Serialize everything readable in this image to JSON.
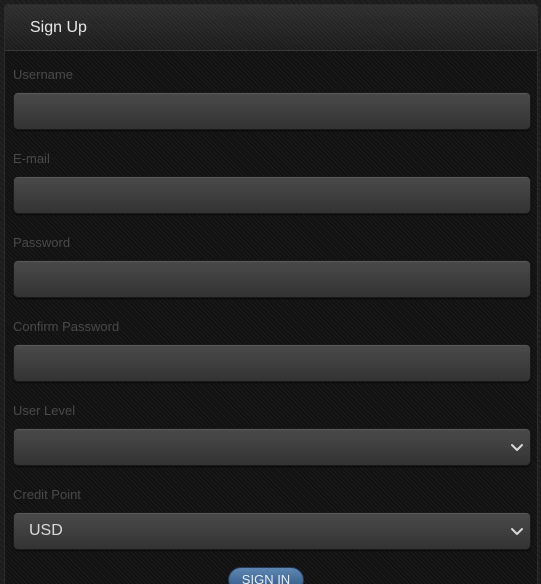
{
  "panel": {
    "title": "Sign Up"
  },
  "form": {
    "username_label": "Username",
    "email_label": "E-mail",
    "password_label": "Password",
    "confirm_password_label": "Confirm Password",
    "user_level_label": "User Level",
    "user_level_value": "",
    "credit_point_label": "Credit Point",
    "credit_point_value": "USD"
  },
  "actions": {
    "sign_in_label": "SIGN IN"
  }
}
